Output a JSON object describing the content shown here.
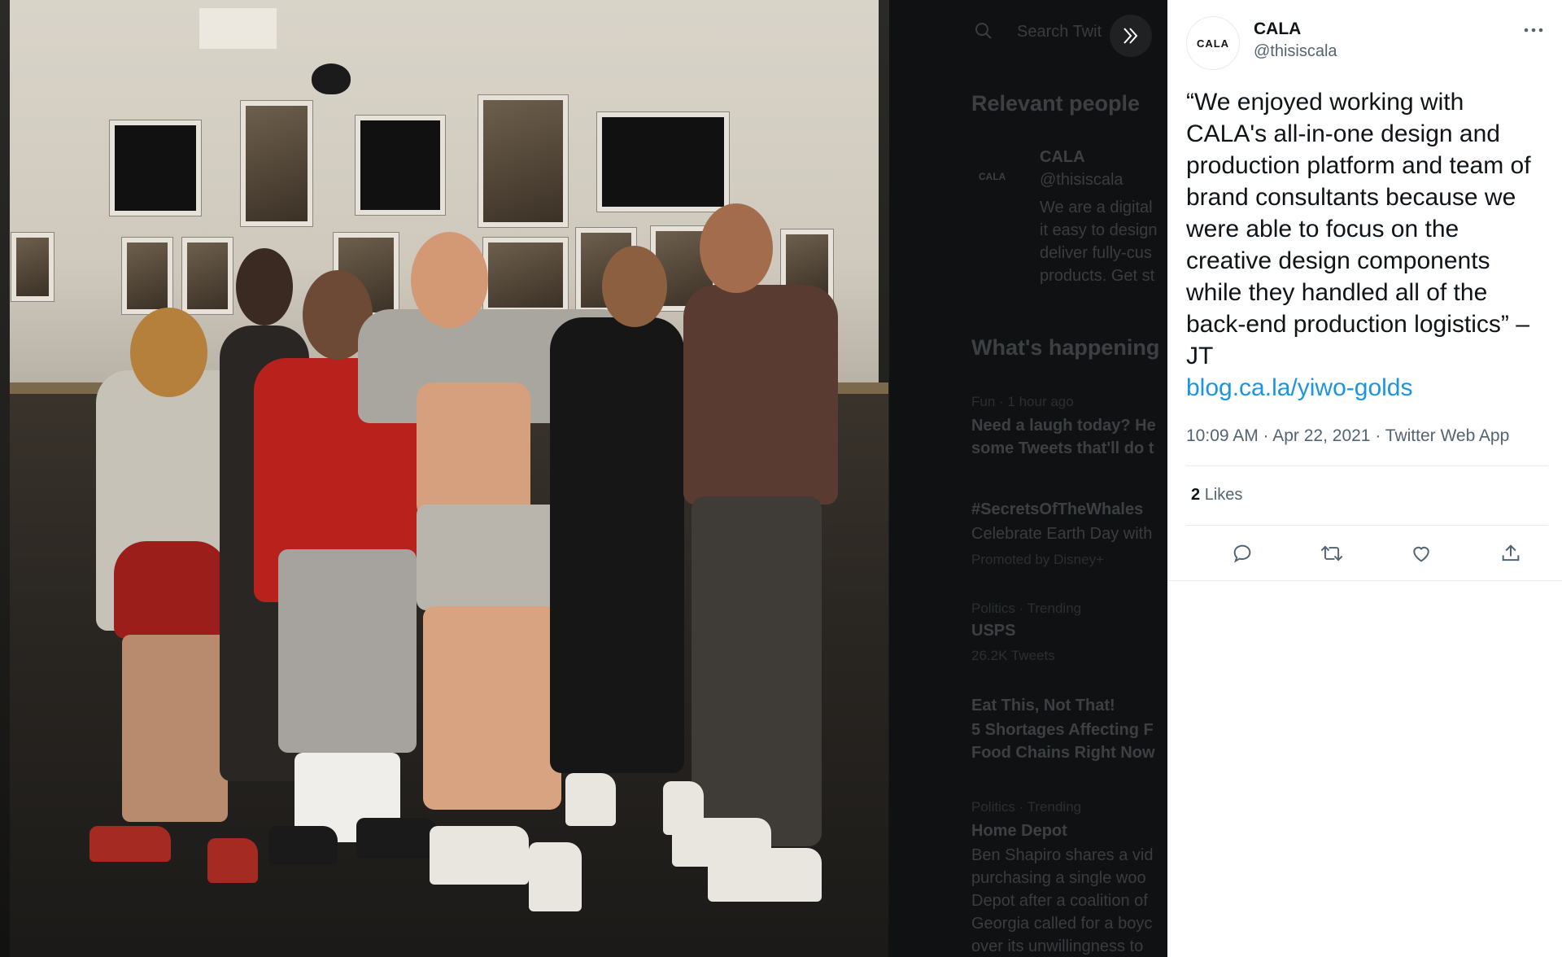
{
  "photo": {
    "alt_icon": "photo"
  },
  "background": {
    "search_placeholder": "Search Twit",
    "relevant_people_title": "Relevant people",
    "rp_name": "CALA",
    "rp_handle": "@thisiscala",
    "rp_bio": [
      "We are a digital",
      "it easy to design",
      "deliver fully-cus",
      "products. Get st"
    ],
    "whats_happening_title": "What's happening",
    "trends": [
      {
        "meta": "Fun · 1 hour ago",
        "line1": "Need a laugh today? He",
        "line2": "some Tweets that'll do t"
      },
      {
        "meta": "",
        "line1": "#SecretsOfTheWhales",
        "line2": "Celebrate Earth Day with",
        "promo": "Promoted by Disney+"
      },
      {
        "meta": "Politics · Trending",
        "line1": "USPS",
        "line2": "26.2K Tweets"
      },
      {
        "meta": "Eat This, Not That!",
        "line1": "5 Shortages Affecting F",
        "line2": "Food Chains Right Now"
      },
      {
        "meta": "Politics · Trending",
        "line1": "Home Depot",
        "line2": "Ben Shapiro shares a vid",
        "line3": "purchasing a single woo",
        "line4": "Depot after a coalition of",
        "line5": "Georgia called for a boyc",
        "line6": "over its unwillingness to"
      }
    ]
  },
  "tweet": {
    "avatar_text": "CALA",
    "name": "CALA",
    "handle": "@thisiscala",
    "more_icon": "more-icon",
    "text": "“We enjoyed working with CALA's all-in-one design and production platform and team of brand consultants because we were able to focus on the creative design components while they handled all of the back-end production logistics” – JT",
    "link": "blog.ca.la/yiwo-golds",
    "timestamp": "10:09 AM · Apr 22, 2021 · Twitter Web App",
    "likes_count": "2",
    "likes_label": "Likes"
  },
  "actions": {
    "reply_icon": "reply-icon",
    "retweet_icon": "retweet-icon",
    "like_icon": "like-icon",
    "share_icon": "share-icon"
  }
}
